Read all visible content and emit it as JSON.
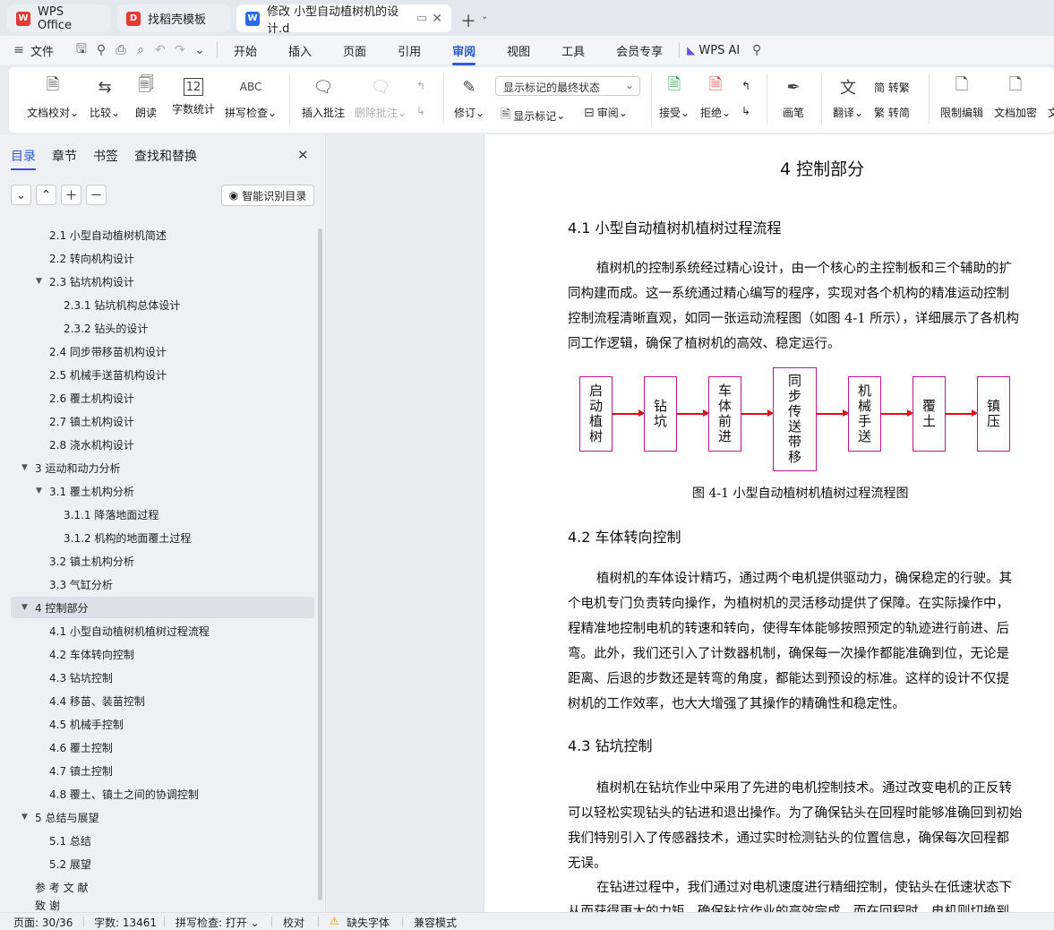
{
  "tabs": [
    {
      "label": "WPS Office",
      "icon": "wps-logo-icon"
    },
    {
      "label": "找稻壳模板",
      "icon": "docer-icon"
    },
    {
      "label": "修改 小型自动植树机的设计.d",
      "icon": "word-doc-icon"
    }
  ],
  "menu": {
    "file": "文件",
    "items": [
      "开始",
      "插入",
      "页面",
      "引用",
      "审阅",
      "视图",
      "工具",
      "会员专享"
    ],
    "active": "审阅",
    "ai": "WPS AI"
  },
  "ribbon": {
    "doc_check": "文档校对",
    "compare": "比较",
    "read_aloud": "朗读",
    "word_count": "字数统计",
    "spell_check": "拼写检查",
    "insert_comment": "插入批注",
    "delete_comment": "删除批注",
    "track": "修订",
    "markup_dropdown": "显示标记的最终状态",
    "show_markup": "显示标记",
    "review": "审阅",
    "accept": "接受",
    "reject": "拒绝",
    "pen": "画笔",
    "translate": "翻译",
    "to_traditional": "简 转繁",
    "to_simplified": "繁 转简",
    "restrict_edit": "限制编辑",
    "doc_encrypt": "文档加密",
    "more": "文"
  },
  "nav": {
    "tabs": [
      "目录",
      "章节",
      "书签",
      "查找和替换"
    ],
    "smart_toc": "智能识别目录",
    "items": [
      {
        "text": "2.1   小型自动植树机简述"
      },
      {
        "text": "2.2   转向机构设计"
      },
      {
        "text": "2.3   钻坑机构设计"
      },
      {
        "text": "2.3.1 钻坑机构总体设计"
      },
      {
        "text": "2.3.2   钻头的设计"
      },
      {
        "text": "2.4   同步带移苗机构设计"
      },
      {
        "text": "2.5   机械手送苗机构设计"
      },
      {
        "text": "2.6   覆土机构设计"
      },
      {
        "text": "2.7   镇土机构设计"
      },
      {
        "text": "2.8   浇水机构设计"
      },
      {
        "text": "3   运动和动力分析"
      },
      {
        "text": "3.1   覆土机构分析"
      },
      {
        "text": "3.1.1   降落地面过程"
      },
      {
        "text": "3.1.2  机构的地面覆土过程"
      },
      {
        "text": "3.2  镇土机构分析"
      },
      {
        "text": "3.3  气缸分析"
      },
      {
        "text": "4   控制部分"
      },
      {
        "text": "4.1   小型自动植树机植树过程流程"
      },
      {
        "text": "4.2   车体转向控制"
      },
      {
        "text": "4.3   钻坑控制"
      },
      {
        "text": "4.4   移苗、装苗控制"
      },
      {
        "text": "4.5   机械手控制"
      },
      {
        "text": "4.6   覆土控制"
      },
      {
        "text": "4.7   镇土控制"
      },
      {
        "text": "4.8   覆土、镇土之间的协调控制"
      },
      {
        "text": "5   总结与展望"
      },
      {
        "text": "5.1   总结"
      },
      {
        "text": "5.2   展望"
      },
      {
        "text": "参 考 文 献"
      },
      {
        "text": "致   谢"
      }
    ]
  },
  "doc": {
    "h1": "4   控制部分",
    "h41": "4.1   小型自动植树机植树过程流程",
    "p1": [
      "植树机的控制系统经过精心设计，由一个核心的主控制板和三个辅助的扩",
      "同构建而成。这一系统通过精心编写的程序，实现对各个机构的精准运动控制",
      "控制流程清晰直观，如同一张运动流程图（如图 4-1 所示），详细展示了各机构",
      "同工作逻辑，确保了植树机的高效、稳定运行。"
    ],
    "flow": [
      "启动植树",
      "钻坑",
      "车体前进",
      "同步传送带移",
      "机械手送",
      "覆土",
      "镇压"
    ],
    "caption": "图 4-1    小型自动植树机植树过程流程图",
    "h42": "4.2   车体转向控制",
    "p2": [
      "植树机的车体设计精巧，通过两个电机提供驱动力，确保稳定的行驶。其",
      "个电机专门负责转向操作，为植树机的灵活移动提供了保障。在实际操作中，",
      "程精准地控制电机的转速和转向，使得车体能够按照预定的轨迹进行前进、后",
      "弯。此外，我们还引入了计数器机制，确保每一次操作都能准确到位，无论是",
      "距离、后退的步数还是转弯的角度，都能达到预设的标准。这样的设计不仅提",
      "树机的工作效率，也大大增强了其操作的精确性和稳定性。"
    ],
    "h43": "4.3   钻坑控制",
    "p3": [
      "植树机在钻坑作业中采用了先进的电机控制技术。通过改变电机的正反转",
      "可以轻松实现钻头的钻进和退出操作。为了确保钻头在回程时能够准确回到初始",
      "我们特别引入了传感器技术，通过实时检测钻头的位置信息，确保每次回程都",
      "无误。",
      "在钻进过程中，我们通过对电机速度进行精细控制，使钻头在低速状态下",
      "从而获得更大的力矩，确保钻坑作业的高效完成。而在回程时，电机则切换到"
    ]
  },
  "status": {
    "page": "页面: 30/36",
    "words": "字数: 13461",
    "spell": "拼写检查: 打开",
    "proof": "校对",
    "missing_font": "缺失字体",
    "compat": "兼容模式"
  }
}
